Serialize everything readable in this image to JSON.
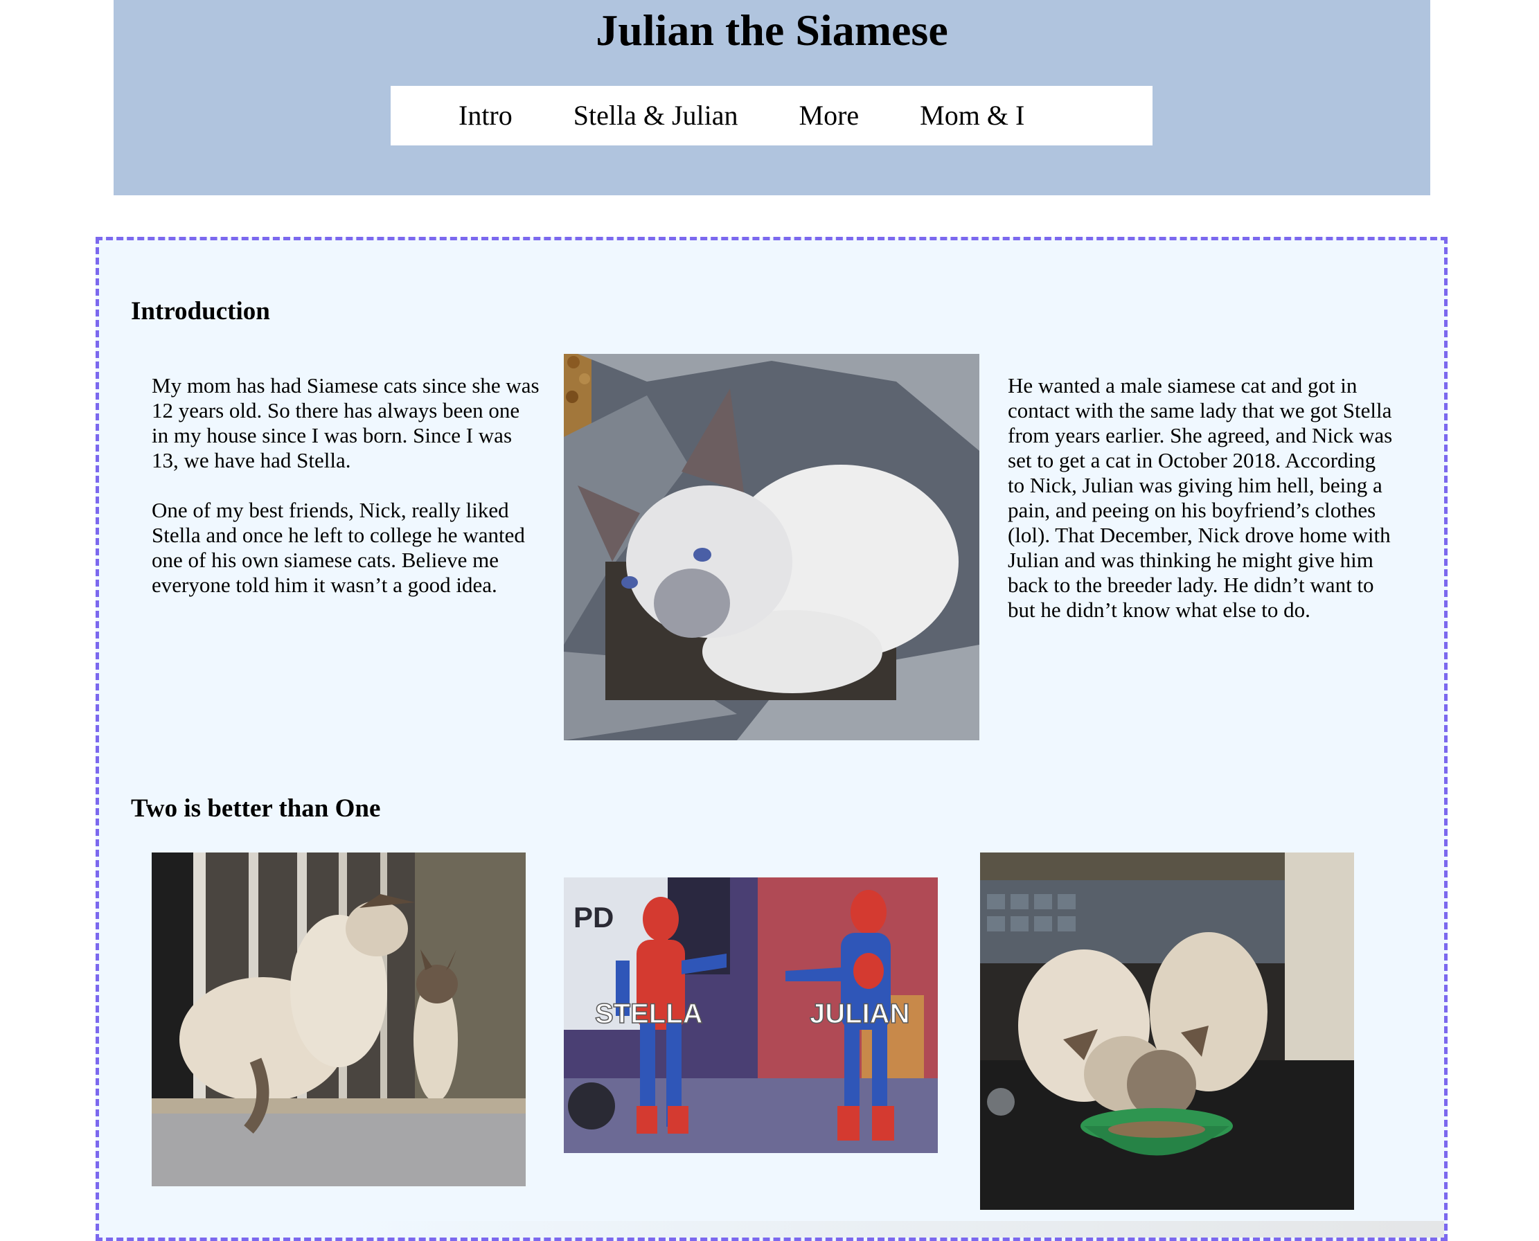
{
  "header": {
    "title": "Julian the Siamese",
    "nav": [
      {
        "label": "Intro"
      },
      {
        "label": "Stella & Julian"
      },
      {
        "label": "More"
      },
      {
        "label": "Mom & I"
      }
    ]
  },
  "intro": {
    "heading": "Introduction",
    "left_paragraphs": [
      "My mom has had Siamese cats since she was 12 years old. So there has always been one in my house since I was born. Since I was 13, we have had Stella.",
      "One of my best friends, Nick, really liked Stella and once he left to college he wanted one of his own siamese cats. Believe me everyone told him it wasn’t a good idea."
    ],
    "right_paragraph": "He wanted a male siamese cat and got in contact with the same lady that we got Stella from years earlier. She agreed, and Nick was set to get a cat in October 2018. According to Nick, Julian was giving him hell, being a pain, and peeing on his boyfriend’s clothes (lol). That December, Nick drove home with Julian and was thinking he might give him back to the breeder lady. He didn’t want to but he didn’t know what else to do."
  },
  "two": {
    "heading": "Two is better than One",
    "meme_labels": [
      "STELLA",
      "JULIAN"
    ],
    "meme_sign": "PD"
  },
  "colors": {
    "header_bg": "#b0c4de",
    "main_bg": "#f0f8ff",
    "border": "#7b68ee"
  }
}
